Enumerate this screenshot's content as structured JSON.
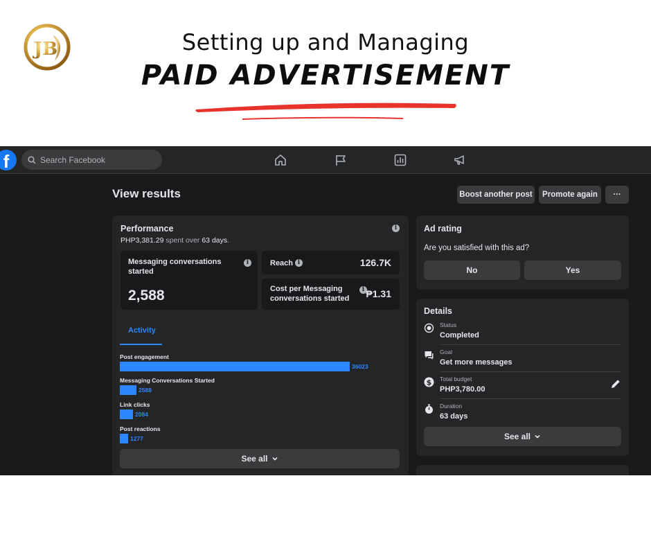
{
  "banner": {
    "line1": "Setting up and Managing",
    "line2": "PAID ADVERTISEMENT",
    "logo_text": "JB",
    "accent_color": "#e8322c"
  },
  "topbar": {
    "search_placeholder": "Search Facebook",
    "fb_letter": "f",
    "nav_icons": [
      "home-icon",
      "flag-icon",
      "insights-icon",
      "megaphone-icon"
    ]
  },
  "header": {
    "title": "View results",
    "buttons": {
      "boost": "Boost another post",
      "promote": "Promote again",
      "more": "···"
    }
  },
  "performance": {
    "title": "Performance",
    "spent": "PHP3,381.29",
    "spent_suffix": " spent over ",
    "days": "63 days",
    "days_suffix": ".",
    "metrics": {
      "messaging_label": "Messaging conversations started",
      "messaging_value": "2,588",
      "reach_label": "Reach",
      "reach_value": "126.7K",
      "cost_label": "Cost per Messaging conversations started",
      "cost_value": "₱1.31"
    },
    "tab": "Activity",
    "activity": [
      {
        "label": "Post engagement",
        "value": 36023,
        "display": "36023"
      },
      {
        "label": "Messaging Conversations Started",
        "value": 2588,
        "display": "2588"
      },
      {
        "label": "Link clicks",
        "value": 2084,
        "display": "2084"
      },
      {
        "label": "Post reactions",
        "value": 1277,
        "display": "1277"
      }
    ],
    "see_all": "See all"
  },
  "ad_rating": {
    "title": "Ad rating",
    "question": "Are you satisfied with this ad?",
    "no": "No",
    "yes": "Yes"
  },
  "details": {
    "title": "Details",
    "items": [
      {
        "label": "Status",
        "value": "Completed",
        "icon": "status-icon"
      },
      {
        "label": "Goal",
        "value": "Get more messages",
        "icon": "chat-icon"
      },
      {
        "label": "Total budget",
        "value": "PHP3,780.00",
        "icon": "dollar-icon"
      },
      {
        "label": "Duration",
        "value": "63 days",
        "icon": "stopwatch-icon"
      }
    ],
    "see_all": "See all"
  },
  "colors": {
    "fb_blue": "#1877f2",
    "bar_blue": "#2d88ff",
    "dark_bg": "#18191a",
    "card_bg": "#242526"
  }
}
